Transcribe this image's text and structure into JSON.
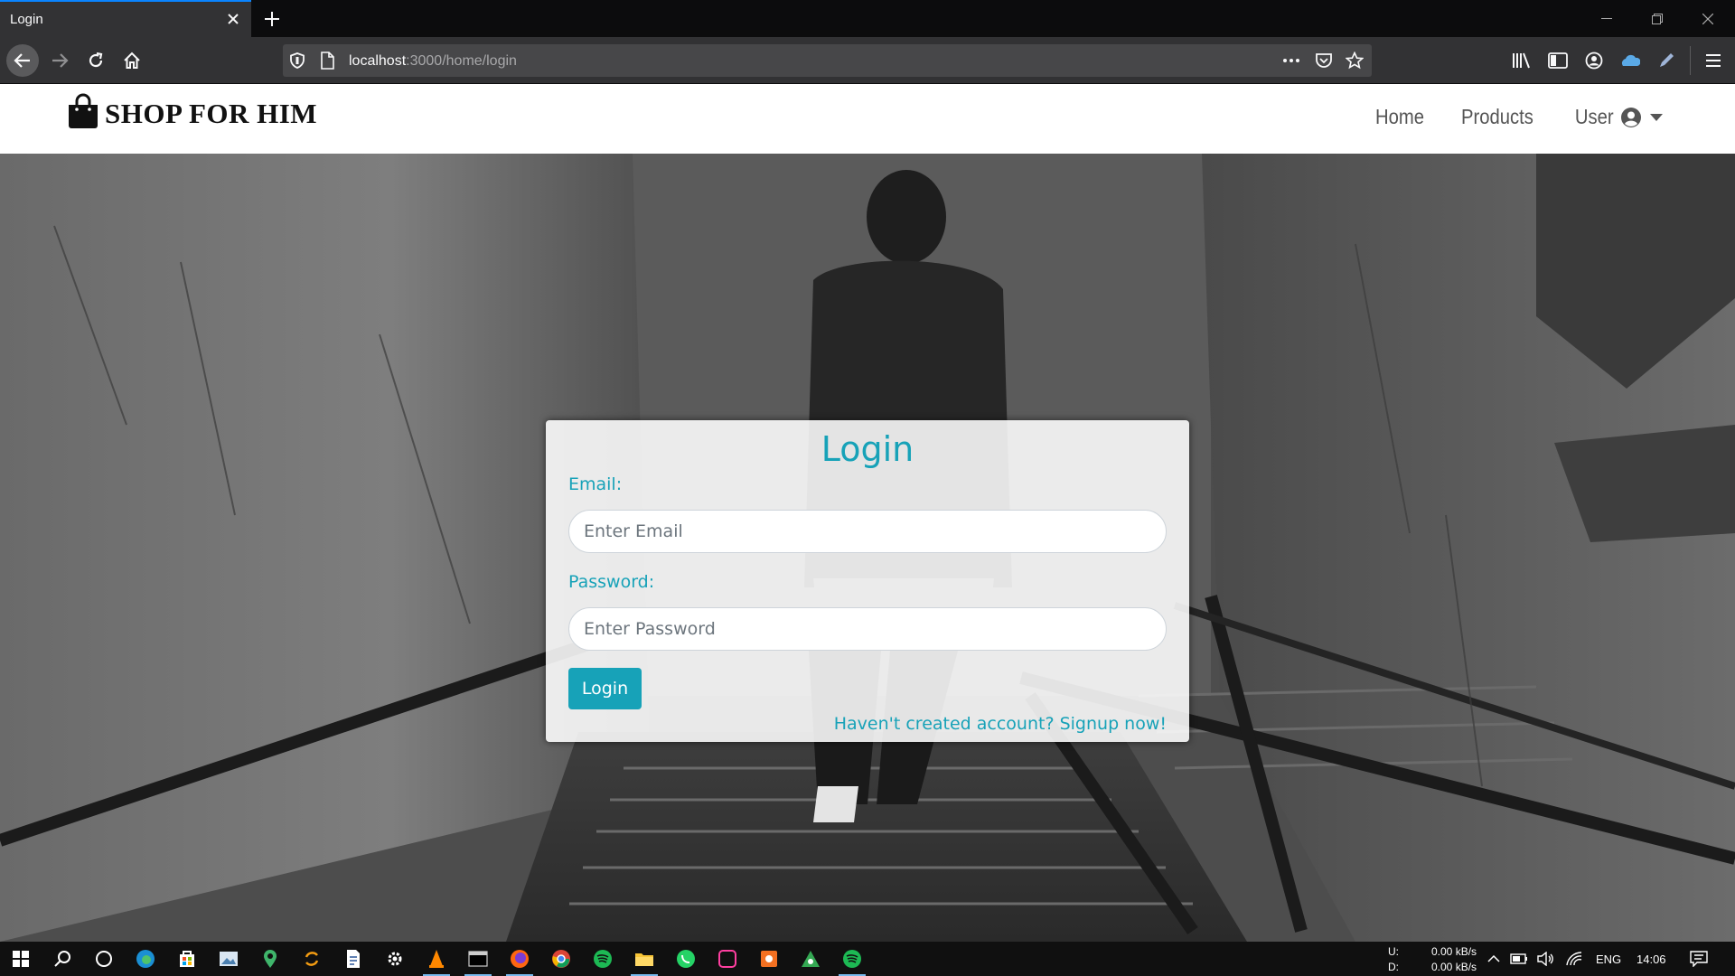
{
  "browser": {
    "tab_title": "Login",
    "url_host": "localhost",
    "url_path": ":3000/home/login"
  },
  "site": {
    "brand": "SHOP FOR HIM",
    "nav": {
      "home": "Home",
      "products": "Products",
      "user": "User"
    }
  },
  "login": {
    "title": "Login",
    "email_label": "Email:",
    "email_placeholder": "Enter Email",
    "password_label": "Password:",
    "password_placeholder": "Enter Password",
    "submit": "Login",
    "signup": "Haven't created account? Signup now!"
  },
  "taskbar": {
    "net_up_label": "U:",
    "net_down_label": "D:",
    "net_up": "0.00 kB/s",
    "net_down": "0.00 kB/s",
    "lang": "ENG",
    "time": "14:06"
  },
  "colors": {
    "accent": "#17a2b8",
    "browser_bg": "#323234",
    "tab_highlight": "#0a84ff"
  }
}
